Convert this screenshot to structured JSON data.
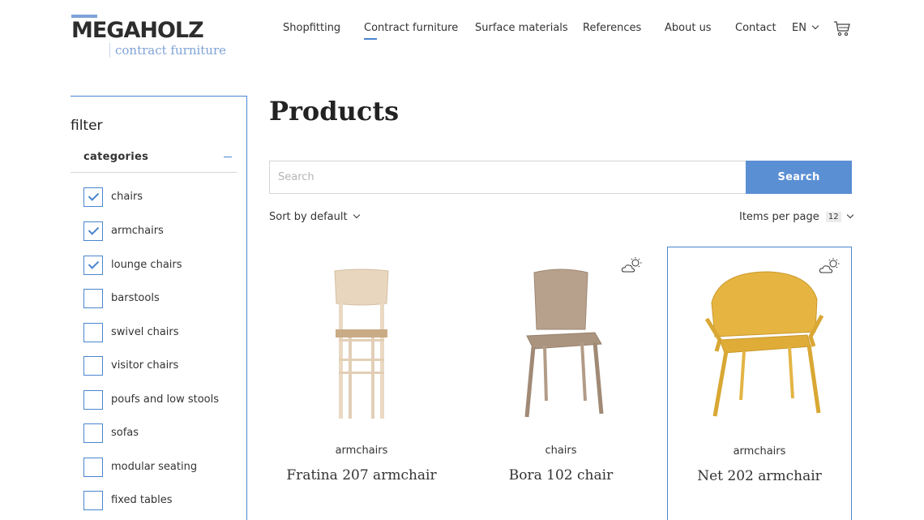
{
  "header": {
    "logo_main": "MEGAHOLZ",
    "logo_sub": "contract furniture",
    "nav": [
      {
        "label": "Shopfitting"
      },
      {
        "label": "Contract furniture"
      },
      {
        "label": "Surface materials"
      },
      {
        "label": "References"
      },
      {
        "label": "About us"
      },
      {
        "label": "Contact"
      }
    ],
    "language": "EN",
    "cart_icon": "cart-icon"
  },
  "sidebar": {
    "title": "filter",
    "categories_label": "categories",
    "items": [
      {
        "label": "chairs",
        "checked": true
      },
      {
        "label": "armchairs",
        "checked": true
      },
      {
        "label": "lounge chairs",
        "checked": true
      },
      {
        "label": "barstools",
        "checked": false
      },
      {
        "label": "swivel chairs",
        "checked": false
      },
      {
        "label": "visitor chairs",
        "checked": false
      },
      {
        "label": "poufs and low stools",
        "checked": false
      },
      {
        "label": "sofas",
        "checked": false
      },
      {
        "label": "modular seating",
        "checked": false
      },
      {
        "label": "fixed tables",
        "checked": false
      }
    ]
  },
  "main": {
    "title": "Products",
    "search": {
      "placeholder": "Search",
      "button": "Search"
    },
    "sort_label": "Sort by default",
    "items_per_page_label": "Items per page",
    "items_per_page_value": "12",
    "products": [
      {
        "category": "armchairs",
        "name": "Fratina 207 armchair",
        "outdoor": false
      },
      {
        "category": "chairs",
        "name": "Bora 102 chair",
        "outdoor": true
      },
      {
        "category": "armchairs",
        "name": "Net 202 armchair",
        "outdoor": true
      }
    ]
  },
  "colors": {
    "accent": "#4a86cf",
    "search_button": "#5b8fd4",
    "logo_blue": "#7fa3d6"
  }
}
